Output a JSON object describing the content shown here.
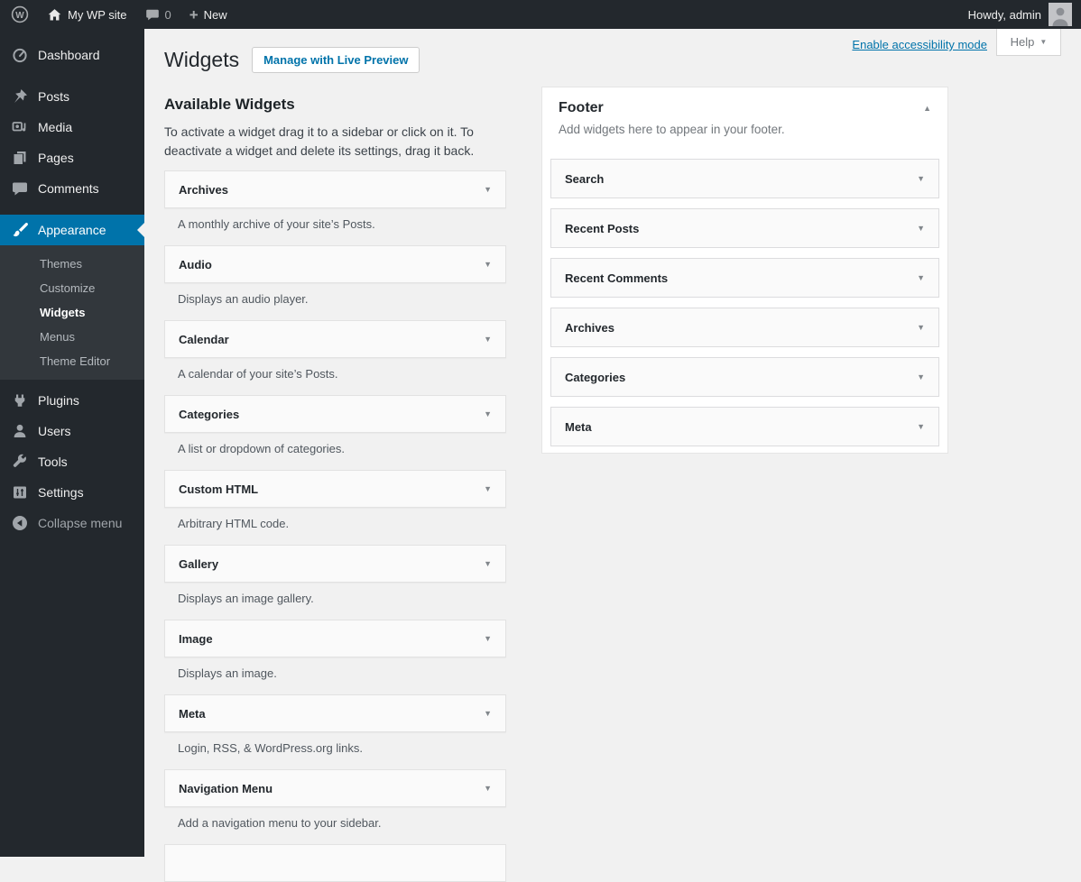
{
  "admin_bar": {
    "site_name": "My WP site",
    "comments_count": "0",
    "new_label": "New",
    "howdy": "Howdy, admin"
  },
  "sidebar": {
    "items": [
      {
        "label": "Dashboard"
      },
      {
        "label": "Posts"
      },
      {
        "label": "Media"
      },
      {
        "label": "Pages"
      },
      {
        "label": "Comments"
      },
      {
        "label": "Appearance"
      },
      {
        "label": "Plugins"
      },
      {
        "label": "Users"
      },
      {
        "label": "Tools"
      },
      {
        "label": "Settings"
      },
      {
        "label": "Collapse menu"
      }
    ],
    "appearance_submenu": [
      {
        "label": "Themes"
      },
      {
        "label": "Customize"
      },
      {
        "label": "Widgets"
      },
      {
        "label": "Menus"
      },
      {
        "label": "Theme Editor"
      }
    ]
  },
  "header": {
    "title": "Widgets",
    "manage_button": "Manage with Live Preview",
    "accessibility_link": "Enable accessibility mode",
    "help_label": "Help"
  },
  "available": {
    "heading": "Available Widgets",
    "description": "To activate a widget drag it to a sidebar or click on it. To deactivate a widget and delete its settings, drag it back.",
    "widgets": [
      {
        "name": "Archives",
        "description": "A monthly archive of your site’s Posts."
      },
      {
        "name": "Audio",
        "description": "Displays an audio player."
      },
      {
        "name": "Calendar",
        "description": "A calendar of your site’s Posts."
      },
      {
        "name": "Categories",
        "description": "A list or dropdown of categories."
      },
      {
        "name": "Custom HTML",
        "description": "Arbitrary HTML code."
      },
      {
        "name": "Gallery",
        "description": "Displays an image gallery."
      },
      {
        "name": "Image",
        "description": "Displays an image."
      },
      {
        "name": "Meta",
        "description": "Login, RSS, & WordPress.org links."
      },
      {
        "name": "Navigation Menu",
        "description": "Add a navigation menu to your sidebar."
      }
    ]
  },
  "footer_area": {
    "title": "Footer",
    "description": "Add widgets here to appear in your footer.",
    "widgets": [
      "Search",
      "Recent Posts",
      "Recent Comments",
      "Archives",
      "Categories",
      "Meta"
    ]
  },
  "icons": {
    "toggle_down": "▼",
    "toggle_up": "▲",
    "plus": "+"
  },
  "colors": {
    "accent": "#0073aa",
    "admin_bar_bg": "#23282d",
    "submenu_bg": "#32373c",
    "page_bg": "#f1f1f1",
    "card_bg": "#fafafa"
  }
}
